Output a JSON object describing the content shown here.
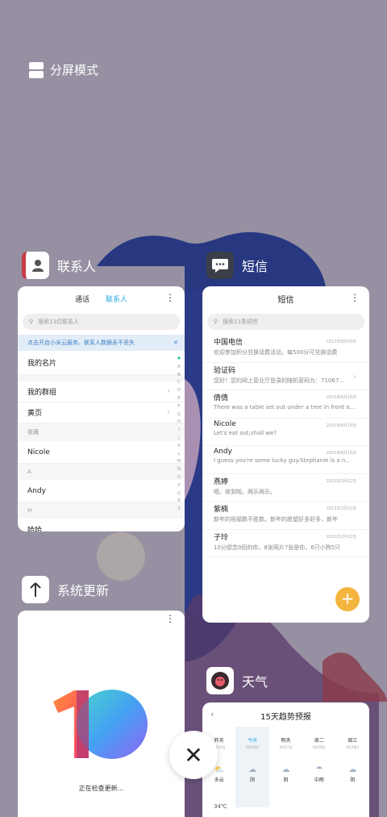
{
  "split_mode": "分屏模式",
  "apps": {
    "contacts": {
      "name": "联系人",
      "tabs": [
        "通话",
        "联系人"
      ],
      "search_placeholder": "搜索13位联系人",
      "banner": "点击开启小米云服务，联系人数据永不丢失",
      "rows": [
        "我的名片",
        "我的群组",
        "黄页",
        "Nicole",
        "Andy",
        "哈哈"
      ],
      "sections": [
        "收藏",
        "A",
        "H"
      ],
      "alphabet": [
        "♥",
        "A",
        "B",
        "C",
        "D",
        "E",
        "F",
        "G",
        "H",
        "I",
        "J",
        "K",
        "L",
        "M",
        "N",
        "O",
        "P",
        "Q",
        "R",
        "S"
      ]
    },
    "messages": {
      "name": "短信",
      "title": "短信",
      "search_placeholder": "搜索11条短信",
      "items": [
        {
          "name": "中国电信",
          "preview": "欢迎参加积分兑换话费活动，每500分可兑换话费",
          "date": "2017年8月30日"
        },
        {
          "name": "验证码",
          "preview": "您好！您的网上营业厅登录的随机密码为：71067...",
          "date": ""
        },
        {
          "name": "倩倩",
          "preview": "There was a table set out under a tree in front o...",
          "date": "2015年6月15日"
        },
        {
          "name": "Nicole",
          "preview": "Let's eat out,shall we?",
          "date": "2015年6月15日"
        },
        {
          "name": "Andy",
          "preview": "I guess you're some lucky guy.Stephanie is a n...",
          "date": "2015年6月15日"
        },
        {
          "name": "燕婷",
          "preview": "嗯。收到啦。两乐两乐。",
          "date": "2013年2月22日"
        },
        {
          "name": "紫楠",
          "preview": "新年的祝福数不胜数。新年的愿望好多好多，新年",
          "date": "2013年2月22日"
        },
        {
          "name": "子玲",
          "preview": "10分想念9回的你，8张照片7张是你，6只小狗5只",
          "date": "2013年2月22日"
        }
      ]
    },
    "update": {
      "name": "系统更新",
      "status": "正在检查更新..."
    },
    "weather": {
      "name": "天气",
      "title": "15天趋势预报",
      "days": [
        {
          "name": "昨天",
          "date": "6月15日",
          "cond": "多云",
          "icon": "partly-cloudy-icon"
        },
        {
          "name": "今天",
          "date": "6月16日",
          "cond": "阴",
          "icon": "cloud-icon"
        },
        {
          "name": "明天",
          "date": "6月17日",
          "cond": "阴",
          "icon": "cloud-icon"
        },
        {
          "name": "周二",
          "date": "6月18日",
          "cond": "中雨",
          "icon": "rain-icon"
        },
        {
          "name": "周三",
          "date": "6月19日",
          "cond": "阴",
          "icon": "cloud-icon"
        }
      ],
      "temp": "34℃"
    }
  }
}
